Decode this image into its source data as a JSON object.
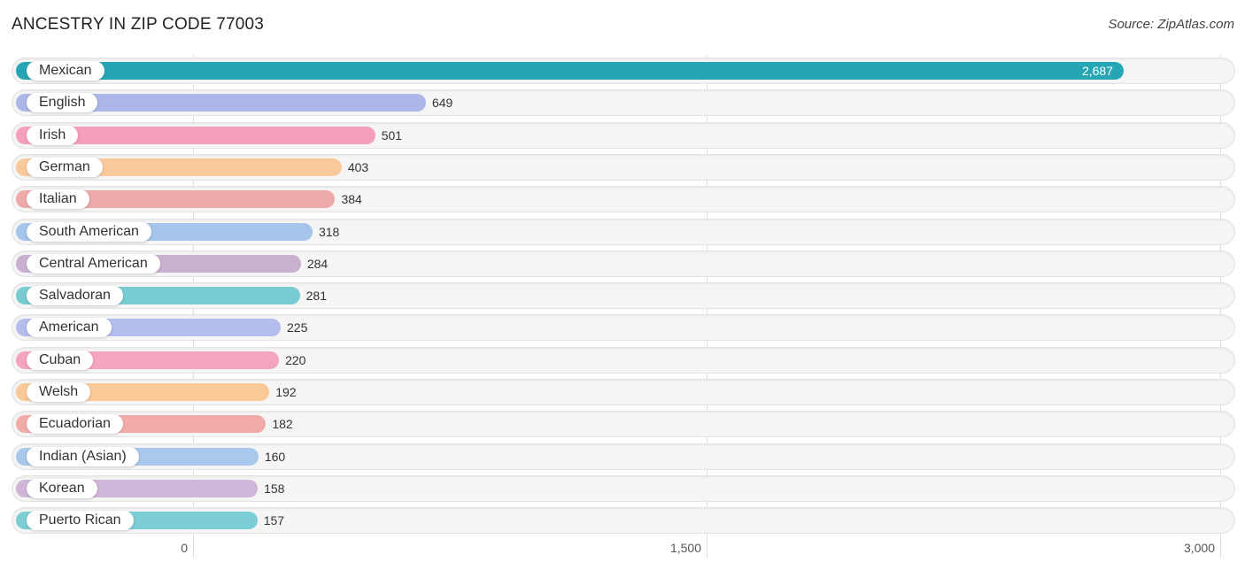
{
  "header": {
    "title": "ANCESTRY IN ZIP CODE 77003",
    "source": "Source: ZipAtlas.com"
  },
  "chart_data": {
    "type": "bar",
    "orientation": "horizontal",
    "title": "ANCESTRY IN ZIP CODE 77003",
    "xlabel": "",
    "ylabel": "",
    "xlim": [
      0,
      3000
    ],
    "x_ticks": [
      0,
      1500,
      3000
    ],
    "x_tick_labels": [
      "0",
      "1,500",
      "3,000"
    ],
    "grid": true,
    "categories": [
      "Mexican",
      "English",
      "Irish",
      "German",
      "Italian",
      "South American",
      "Central American",
      "Salvadoran",
      "American",
      "Cuban",
      "Welsh",
      "Ecuadorian",
      "Indian (Asian)",
      "Korean",
      "Puerto Rican"
    ],
    "values": [
      2687,
      649,
      501,
      403,
      384,
      318,
      284,
      281,
      225,
      220,
      192,
      182,
      160,
      158,
      157
    ],
    "value_labels": [
      "2,687",
      "649",
      "501",
      "403",
      "384",
      "318",
      "284",
      "281",
      "225",
      "220",
      "192",
      "182",
      "160",
      "158",
      "157"
    ],
    "colors": [
      "#26a5b5",
      "#adb7e8",
      "#f59fbb",
      "#fac99b",
      "#eeaaa9",
      "#a6c5ea",
      "#c9b0d1",
      "#7accd3",
      "#b4bdec",
      "#f5a4be",
      "#fbc998",
      "#f1aca8",
      "#a8c8ec",
      "#cfb5d7",
      "#7dcdd4"
    ]
  }
}
